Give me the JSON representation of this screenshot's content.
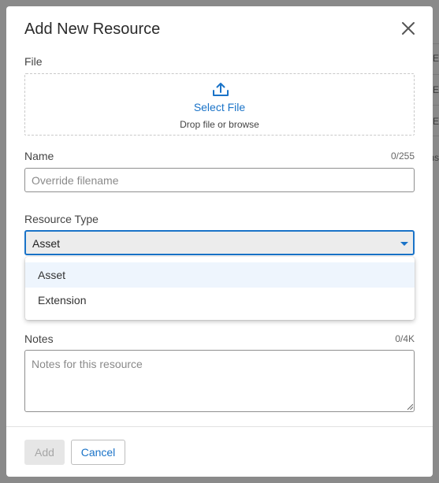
{
  "backdrop": {
    "row_texts": [
      "CE",
      "CE",
      "CE",
      "ns"
    ]
  },
  "modal": {
    "title": "Add New Resource",
    "close_icon": "close-icon"
  },
  "file": {
    "label": "File",
    "upload_icon": "upload-icon",
    "select_text": "Select File",
    "hint": "Drop file or browse"
  },
  "name": {
    "label": "Name",
    "counter": "0/255",
    "value": "",
    "placeholder": "Override filename"
  },
  "resource_type": {
    "label": "Resource Type",
    "selected": "Asset",
    "options": [
      "Asset",
      "Extension"
    ],
    "caret_icon": "caret-down-icon"
  },
  "notes": {
    "label": "Notes",
    "counter": "0/4K",
    "value": "",
    "placeholder": "Notes for this resource"
  },
  "footer": {
    "add_label": "Add",
    "cancel_label": "Cancel"
  },
  "colors": {
    "accent": "#1a73c8",
    "backdrop": "#8a8a8a",
    "selected_option": "#eef5fd"
  }
}
